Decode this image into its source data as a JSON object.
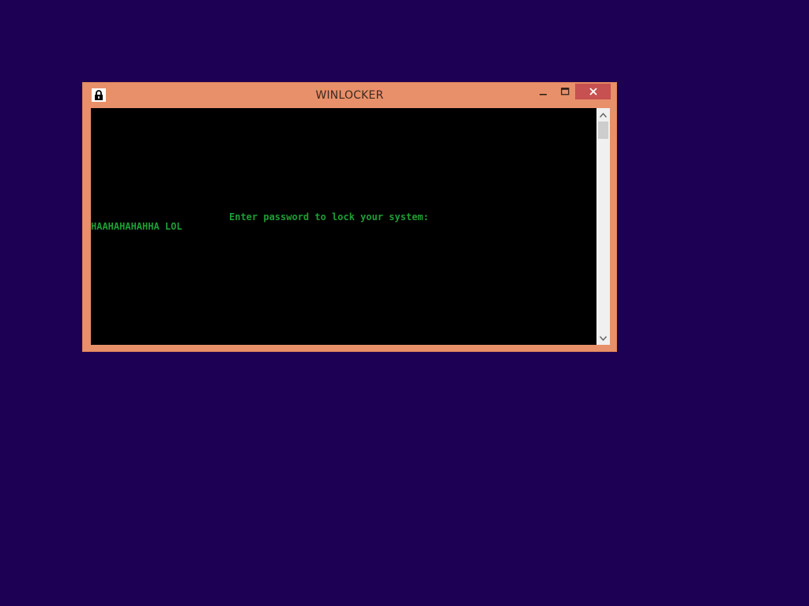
{
  "window": {
    "title": "WINLOCKER",
    "icon": "lock-icon"
  },
  "console": {
    "prompt": "Enter password to lock your system:",
    "input": "HAAHAHAHAHHA LOL",
    "text_color": "#1d9e35",
    "background": "#000000"
  },
  "colors": {
    "desktop": "#1d0054",
    "window_frame": "#e8906a",
    "close_button": "#c75050"
  }
}
